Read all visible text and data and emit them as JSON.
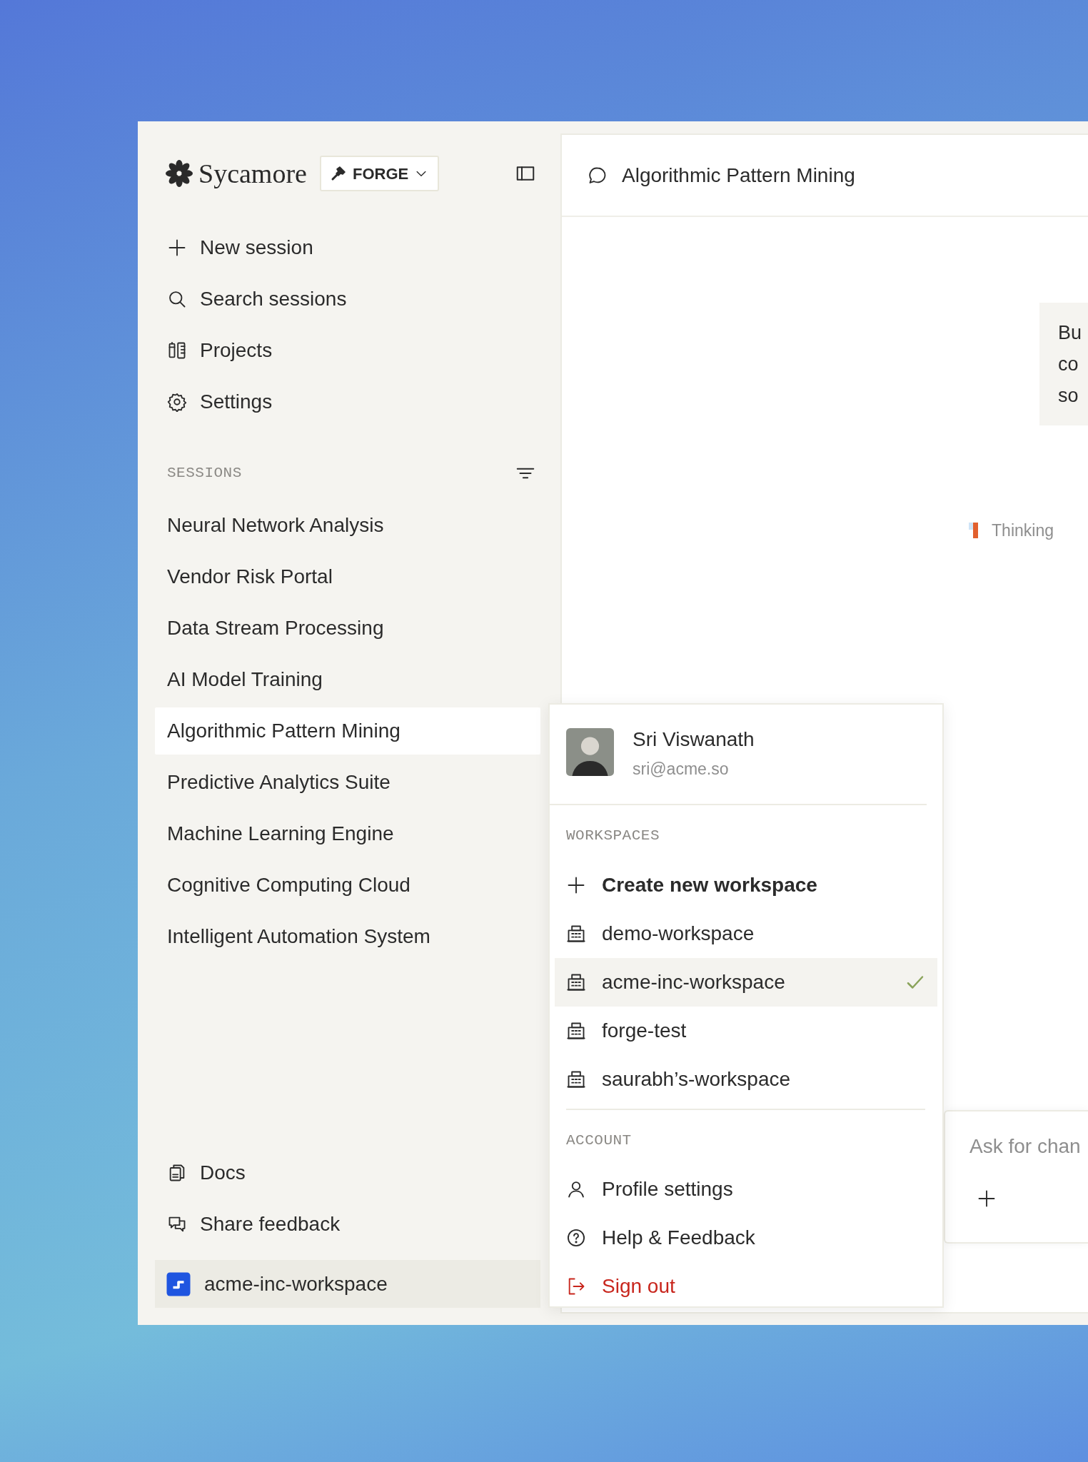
{
  "brand": {
    "name": "Sycamore"
  },
  "mode_button": {
    "label": "FORGE"
  },
  "nav": [
    {
      "label": "New session"
    },
    {
      "label": "Search sessions"
    },
    {
      "label": "Projects"
    },
    {
      "label": "Settings"
    }
  ],
  "sessions": {
    "heading": "SESSIONS",
    "items": [
      {
        "label": "Neural Network Analysis",
        "selected": false
      },
      {
        "label": "Vendor Risk Portal",
        "selected": false
      },
      {
        "label": "Data Stream Processing",
        "selected": false
      },
      {
        "label": "AI Model Training",
        "selected": false
      },
      {
        "label": "Algorithmic Pattern Mining",
        "selected": true
      },
      {
        "label": "Predictive Analytics Suite",
        "selected": false
      },
      {
        "label": "Machine Learning Engine",
        "selected": false
      },
      {
        "label": "Cognitive Computing Cloud",
        "selected": false
      },
      {
        "label": "Intelligent Automation System",
        "selected": false
      }
    ]
  },
  "footer_links": [
    {
      "label": "Docs"
    },
    {
      "label": "Share feedback"
    }
  ],
  "workspace_switcher": {
    "label": "acme-inc-workspace"
  },
  "conversation": {
    "title": "Algorithmic Pattern Mining",
    "message_lines": [
      "Bu",
      "co",
      "so"
    ],
    "status": "Thinking"
  },
  "composer": {
    "placeholder": "Ask for chan"
  },
  "account_menu": {
    "user": {
      "name": "Sri Viswanath",
      "email": "sri@acme.so"
    },
    "workspaces_heading": "WORKSPACES",
    "create_label": "Create new workspace",
    "workspaces": [
      {
        "name": "demo-workspace",
        "selected": false
      },
      {
        "name": "acme-inc-workspace",
        "selected": true
      },
      {
        "name": "forge-test",
        "selected": false
      },
      {
        "name": "saurabh’s-workspace",
        "selected": false
      }
    ],
    "account_heading": "ACCOUNT",
    "account_items": [
      {
        "label": "Profile settings",
        "kind": "default"
      },
      {
        "label": "Help & Feedback",
        "kind": "default"
      },
      {
        "label": "Sign out",
        "kind": "danger"
      }
    ]
  }
}
